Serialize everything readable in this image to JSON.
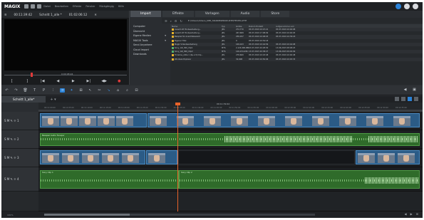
{
  "app": {
    "logo": "MAGIX",
    "menu": [
      "Datei",
      "Bearbeiten",
      "Effekte",
      "Fenster",
      "Rückgängig",
      "Hilfe"
    ]
  },
  "preview": {
    "timecode_left": "00:11:39:42",
    "title": "Schnitt 1_alle *",
    "timecode_right": "01:02:06:12",
    "scrub_timecode": "0:00:08:24",
    "transport": [
      "[",
      "]",
      "|◀",
      "◀",
      "▶",
      "▶|",
      "◀▶",
      "●"
    ]
  },
  "pool": {
    "tabs": [
      "Import",
      "Effekte",
      "Vorlagen",
      "Audio",
      "Store"
    ],
    "active_tab": "Import",
    "path": "E:\\Videos\\Videos_DER_MARKENPRODUKTE\\FESTPLATTE",
    "sidebar": [
      {
        "label": "Computer",
        "arrow": ""
      },
      {
        "label": "Übersicht",
        "arrow": ""
      },
      {
        "label": "Eigene Medien",
        "arrow": "▾"
      },
      {
        "label": "MAGIX Tools",
        "arrow": "▾"
      },
      {
        "label": "Send Anywhere",
        "arrow": ""
      },
      {
        "label": "Cloud Import",
        "arrow": ""
      },
      {
        "label": "Downloads",
        "arrow": ""
      }
    ],
    "columns": [
      "Name",
      "Typ",
      "Größe",
      "Datum Erstellt",
      "Aufgenommen am"
    ],
    "files": [
      {
        "name": "Ausschnitt Tonbearbeitung...",
        "type": "JPG",
        "size": "272,770",
        "created": "05.07.2019 10:47:21",
        "recorded": "05.07.2019 10:40:08",
        "kind": "image"
      },
      {
        "name": "Ausschnitt Tonbearbeitung...",
        "type": "JPG",
        "size": "267,689",
        "created": "05.07.2019 17:08:09",
        "recorded": "05.07.2019 10:40:03",
        "kind": "image"
      },
      {
        "name": "Beispiel für Ansichtsbereich",
        "type": "JPG",
        "size": "256,297",
        "created": "05.07.2019 10:48:03",
        "recorded": "05.07.2019 10:39:18",
        "kind": "image"
      },
      {
        "name": "Eigener Titel",
        "type": "JPG",
        "size": "0",
        "created": "05.07.2019 10:54:18",
        "recorded": "",
        "kind": "image"
      },
      {
        "name": "Magix Videobearbeitung",
        "type": "JPG",
        "size": "169,163",
        "created": "05.07.2019 10:44:56",
        "recorded": "05.07.2019 10:44:08",
        "kind": "image"
      },
      {
        "name": "Sony_GR_360_Clip1",
        "type": "MTS",
        "size": "2,124,990,880",
        "created": "13.07.2015 20:28:30",
        "recorded": "13.06.2015 08:48:23",
        "kind": "audio"
      },
      {
        "name": "Sony_GR_360_Clip2",
        "type": "MTS",
        "size": "126,234,496",
        "created": "13.07.2015 20:38:27",
        "recorded": "13.06.2015 09:02:09",
        "kind": "audio"
      },
      {
        "name": "Timeline_stille 1 (Sp-ort) Clip...",
        "type": "JPG",
        "size": "278,660",
        "created": "05.07.2019 10:43:48",
        "recorded": "05.07.2019 10:40:48",
        "kind": "image"
      },
      {
        "name": "Windows Explorer",
        "type": "JPG",
        "size": "32,608",
        "created": "05.07.2019 10:50:06",
        "recorded": "05.07.2019 10:45:33",
        "kind": "image"
      }
    ]
  },
  "timeline": {
    "project_tab": "Schnitt 1_alle*",
    "ruler_timecode": "00:11:39:42",
    "ruler_ticks": [
      "00:11:00:00",
      "00:11:05:00",
      "00:11:10:00",
      "00:11:15:00",
      "00:11:20:00",
      "00:11:25:00",
      "00:11:30:00",
      "00:11:35:00",
      "00:11:40:00",
      "00:11:45:00",
      "00:11:50:00",
      "00:11:55:00",
      "00:12:00:00",
      "00:12:05:00",
      "00:12:10:00",
      "00:12:15:00",
      "00:12:20:00",
      "00:12:25:00",
      "00:12:30:00",
      "00:12:35:00"
    ],
    "tracks": [
      {
        "label": "S M ✎ ☼ 1",
        "type": "video"
      },
      {
        "label": "S M ✎ ☼ 2",
        "type": "audio",
        "clip_title": "Beispiel Audio Tonspur"
      },
      {
        "label": "S M ✎ ☼ 3",
        "type": "video"
      },
      {
        "label": "S M ✎ ☼ 4",
        "type": "audio",
        "clip_title": "Sony Clip 1",
        "clip_title2": "Sony Clip 2"
      }
    ],
    "status_zoom": "101%"
  },
  "colors": {
    "accent": "#2a82d8",
    "playhead": "#e8632a",
    "video_clip": "#2b5b86",
    "audio_clip": "#2f6b2a",
    "record": "#e03a3a"
  }
}
